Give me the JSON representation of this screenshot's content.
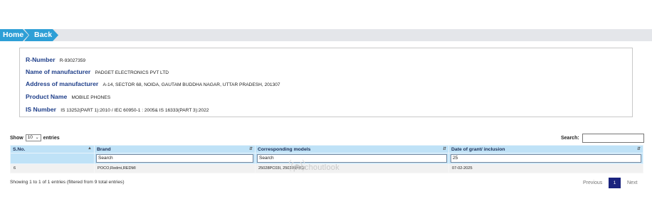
{
  "breadcrumb": {
    "home": "Home",
    "back": "Back"
  },
  "info": {
    "r_number_label": "R-Number",
    "r_number": "R-93027359",
    "manufacturer_label": "Name of manufacturer",
    "manufacturer": "PADGET ELECTRONICS PVT LTD",
    "address_label": "Address of manufacturer",
    "address": "A-14, SECTOR 68, NOIDA, GAUTAM BUDDHA NAGAR, UTTAR PRADESH, 201307",
    "product_label": "Product Name",
    "product": "MOBILE PHONES",
    "is_label": "IS Number",
    "is_number": "IS 13252(PART 1):2010 / IEC 60950-1 : 2005& IS 16333(PART 3):2022"
  },
  "controls": {
    "show_label": "Show",
    "entries_value": "10",
    "entries_label": "entries",
    "search_label": "Search:"
  },
  "table": {
    "headers": [
      "S.No.",
      "Brand",
      "Corresponding models",
      "Date of grant/ inclusion"
    ],
    "filters": {
      "brand_placeholder": "Search",
      "models_placeholder": "Search",
      "date_value": "25"
    },
    "rows": [
      {
        "sno": "6",
        "brand": "POCO,Redmi,REDMI",
        "models": "25028PC03I, 25028RN03I",
        "date": "07-02-2025"
      }
    ]
  },
  "watermark": "ptechoutlook",
  "footer": {
    "info": "Showing 1 to 1 of 1 entries (filtered from 9 total entries)",
    "previous": "Previous",
    "page": "1",
    "next": "Next"
  },
  "colors": {
    "accent": "#2e9fd6",
    "header_bg": "#bfe2f7",
    "label": "#1f3f8a",
    "pager_active": "#1a237e"
  }
}
